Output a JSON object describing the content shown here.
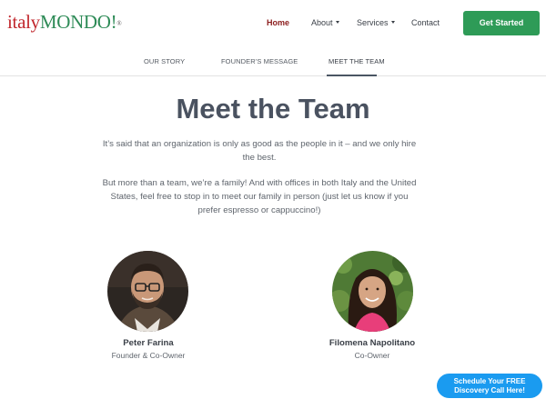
{
  "header": {
    "logo": {
      "part1": "italy",
      "part2": "MONDO",
      "bang": "!",
      "reg": "®"
    },
    "nav": [
      {
        "label": "Home",
        "active": true
      },
      {
        "label": "About",
        "dropdown": true
      },
      {
        "label": "Services",
        "dropdown": true
      },
      {
        "label": "Contact"
      }
    ],
    "cta_label": "Get Started"
  },
  "subnav": {
    "tabs": [
      {
        "label": "OUR STORY"
      },
      {
        "label": "FOUNDER'S MESSAGE"
      },
      {
        "label": "MEET THE TEAM",
        "active": true
      }
    ]
  },
  "main": {
    "title": "Meet the Team",
    "intro": "It’s said that an organization is only as good as the people in it – and we only hire the best.",
    "body": "But more than a team, we’re a family! And with offices in both Italy and the United States, feel free to stop in to meet our family in person (just let us know if you prefer espresso or cappuccino!)"
  },
  "team": [
    {
      "name": "Peter Farina",
      "role": "Founder & Co-Owner"
    },
    {
      "name": "Filomena Napolitano",
      "role": "Co-Owner"
    }
  ],
  "floating_cta": {
    "line1": "Schedule Your FREE",
    "line2": "Discovery Call Here!"
  },
  "colors": {
    "brand_red": "#c1272d",
    "brand_green": "#2e8b57",
    "cta_green": "#2e9b57",
    "float_blue": "#1a9bf0",
    "title": "#4a5260"
  }
}
